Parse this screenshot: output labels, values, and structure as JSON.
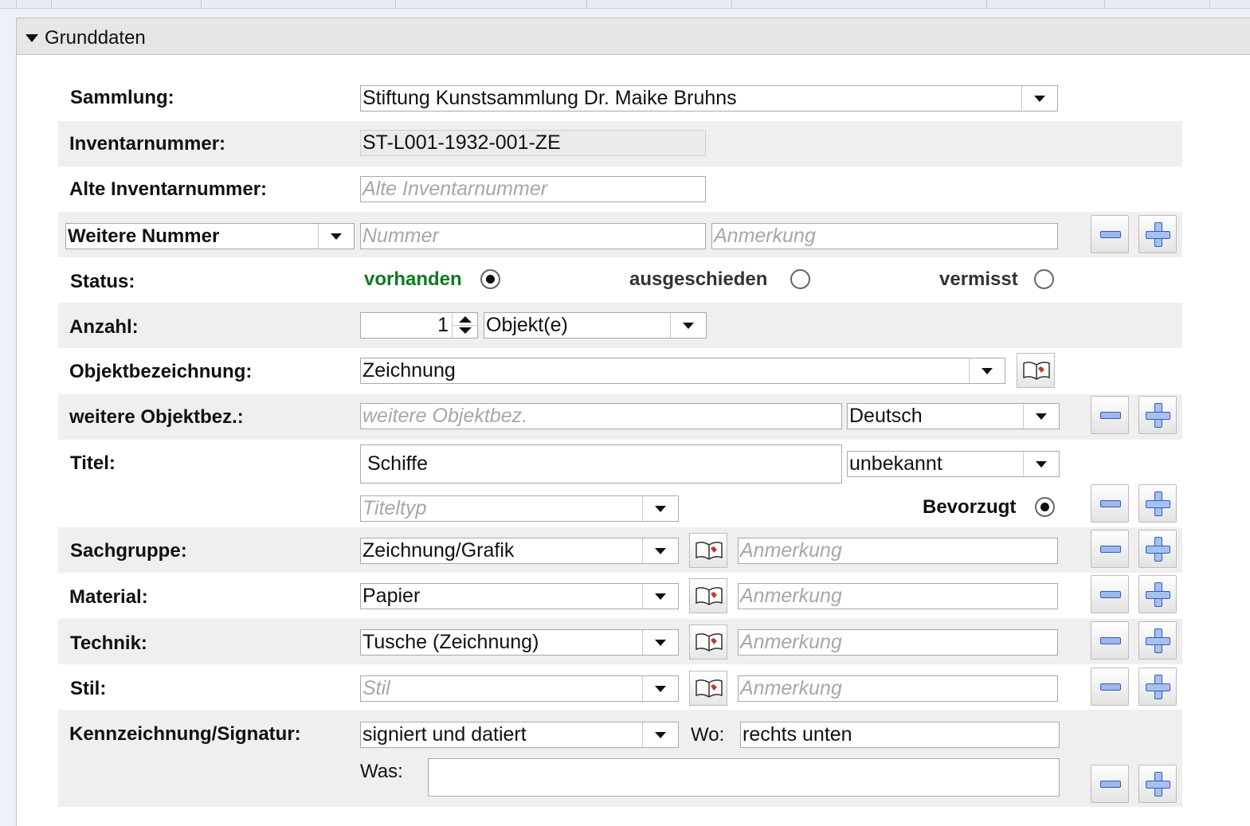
{
  "section": {
    "title": "Grunddaten"
  },
  "sammlung": {
    "label": "Sammlung:",
    "value": "Stiftung Kunstsammlung Dr. Maike Bruhns"
  },
  "inventarnummer": {
    "label": "Inventarnummer:",
    "value": "ST-L001-1932-001-ZE"
  },
  "alte_inventarnummer": {
    "label": "Alte Inventarnummer:",
    "placeholder": "Alte Inventarnummer"
  },
  "weitere_nummer": {
    "label": "Weitere Nummer",
    "nummer_placeholder": "Nummer",
    "anmerkung_placeholder": "Anmerkung"
  },
  "status": {
    "label": "Status:",
    "options": [
      "vorhanden",
      "ausgeschieden",
      "vermisst"
    ],
    "selected": "vorhanden"
  },
  "anzahl": {
    "label": "Anzahl:",
    "value": "1",
    "unit": "Objekt(e)"
  },
  "objektbezeichnung": {
    "label": "Objektbezeichnung:",
    "value": "Zeichnung"
  },
  "weitere_objektbez": {
    "label": "weitere Objektbez.:",
    "placeholder": "weitere Objektbez.",
    "language": "Deutsch"
  },
  "titel": {
    "label": "Titel:",
    "value": "Schiffe",
    "qualifier": "unbekannt",
    "type_placeholder": "Titeltyp",
    "preferred_label": "Bevorzugt"
  },
  "sachgruppe": {
    "label": "Sachgruppe:",
    "value": "Zeichnung/Grafik",
    "anmerkung_placeholder": "Anmerkung"
  },
  "material": {
    "label": "Material:",
    "value": "Papier",
    "anmerkung_placeholder": "Anmerkung"
  },
  "technik": {
    "label": "Technik:",
    "value": "Tusche (Zeichnung)",
    "anmerkung_placeholder": "Anmerkung"
  },
  "stil": {
    "label": "Stil:",
    "placeholder": "Stil",
    "anmerkung_placeholder": "Anmerkung"
  },
  "kennzeichnung": {
    "label": "Kennzeichnung/Signatur:",
    "value": "signiert und datiert",
    "wo_label": "Wo:",
    "wo_value": "rechts unten",
    "was_label": "Was:",
    "was_value": ""
  }
}
